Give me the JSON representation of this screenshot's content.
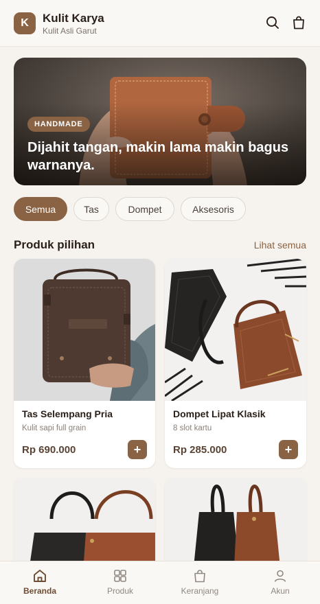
{
  "header": {
    "logo_letter": "K",
    "brand_name": "Kulit Karya",
    "brand_tagline": "Kulit Asli Garut",
    "icons": [
      "search-icon",
      "shopping-bag-icon"
    ]
  },
  "hero": {
    "badge": "HANDMADE",
    "title": "Dijahit tangan, makin lama makin bagus warnanya."
  },
  "categories": [
    {
      "label": "Semua",
      "active": true
    },
    {
      "label": "Tas",
      "active": false
    },
    {
      "label": "Dompet",
      "active": false
    },
    {
      "label": "Aksesoris",
      "active": false
    }
  ],
  "section": {
    "title": "Produk pilihan",
    "see_all": "Lihat semua"
  },
  "products": [
    {
      "name": "Tas Selempang Pria",
      "desc": "Kulit sapi full grain",
      "price": "Rp 690.000",
      "add": "+"
    },
    {
      "name": "Dompet Lipat Klasik",
      "desc": "8 slot kartu",
      "price": "Rp 285.000",
      "add": "+"
    }
  ],
  "bottom_nav": [
    {
      "label": "Beranda",
      "icon": "home-icon",
      "active": true
    },
    {
      "label": "Produk",
      "icon": "grid-icon",
      "active": false
    },
    {
      "label": "Keranjang",
      "icon": "shopping-bag-icon",
      "active": false
    },
    {
      "label": "Akun",
      "icon": "user-icon",
      "active": false
    }
  ],
  "colors": {
    "accent": "#8a6244",
    "background": "#f6f3ef",
    "text": "#2a1f18"
  }
}
